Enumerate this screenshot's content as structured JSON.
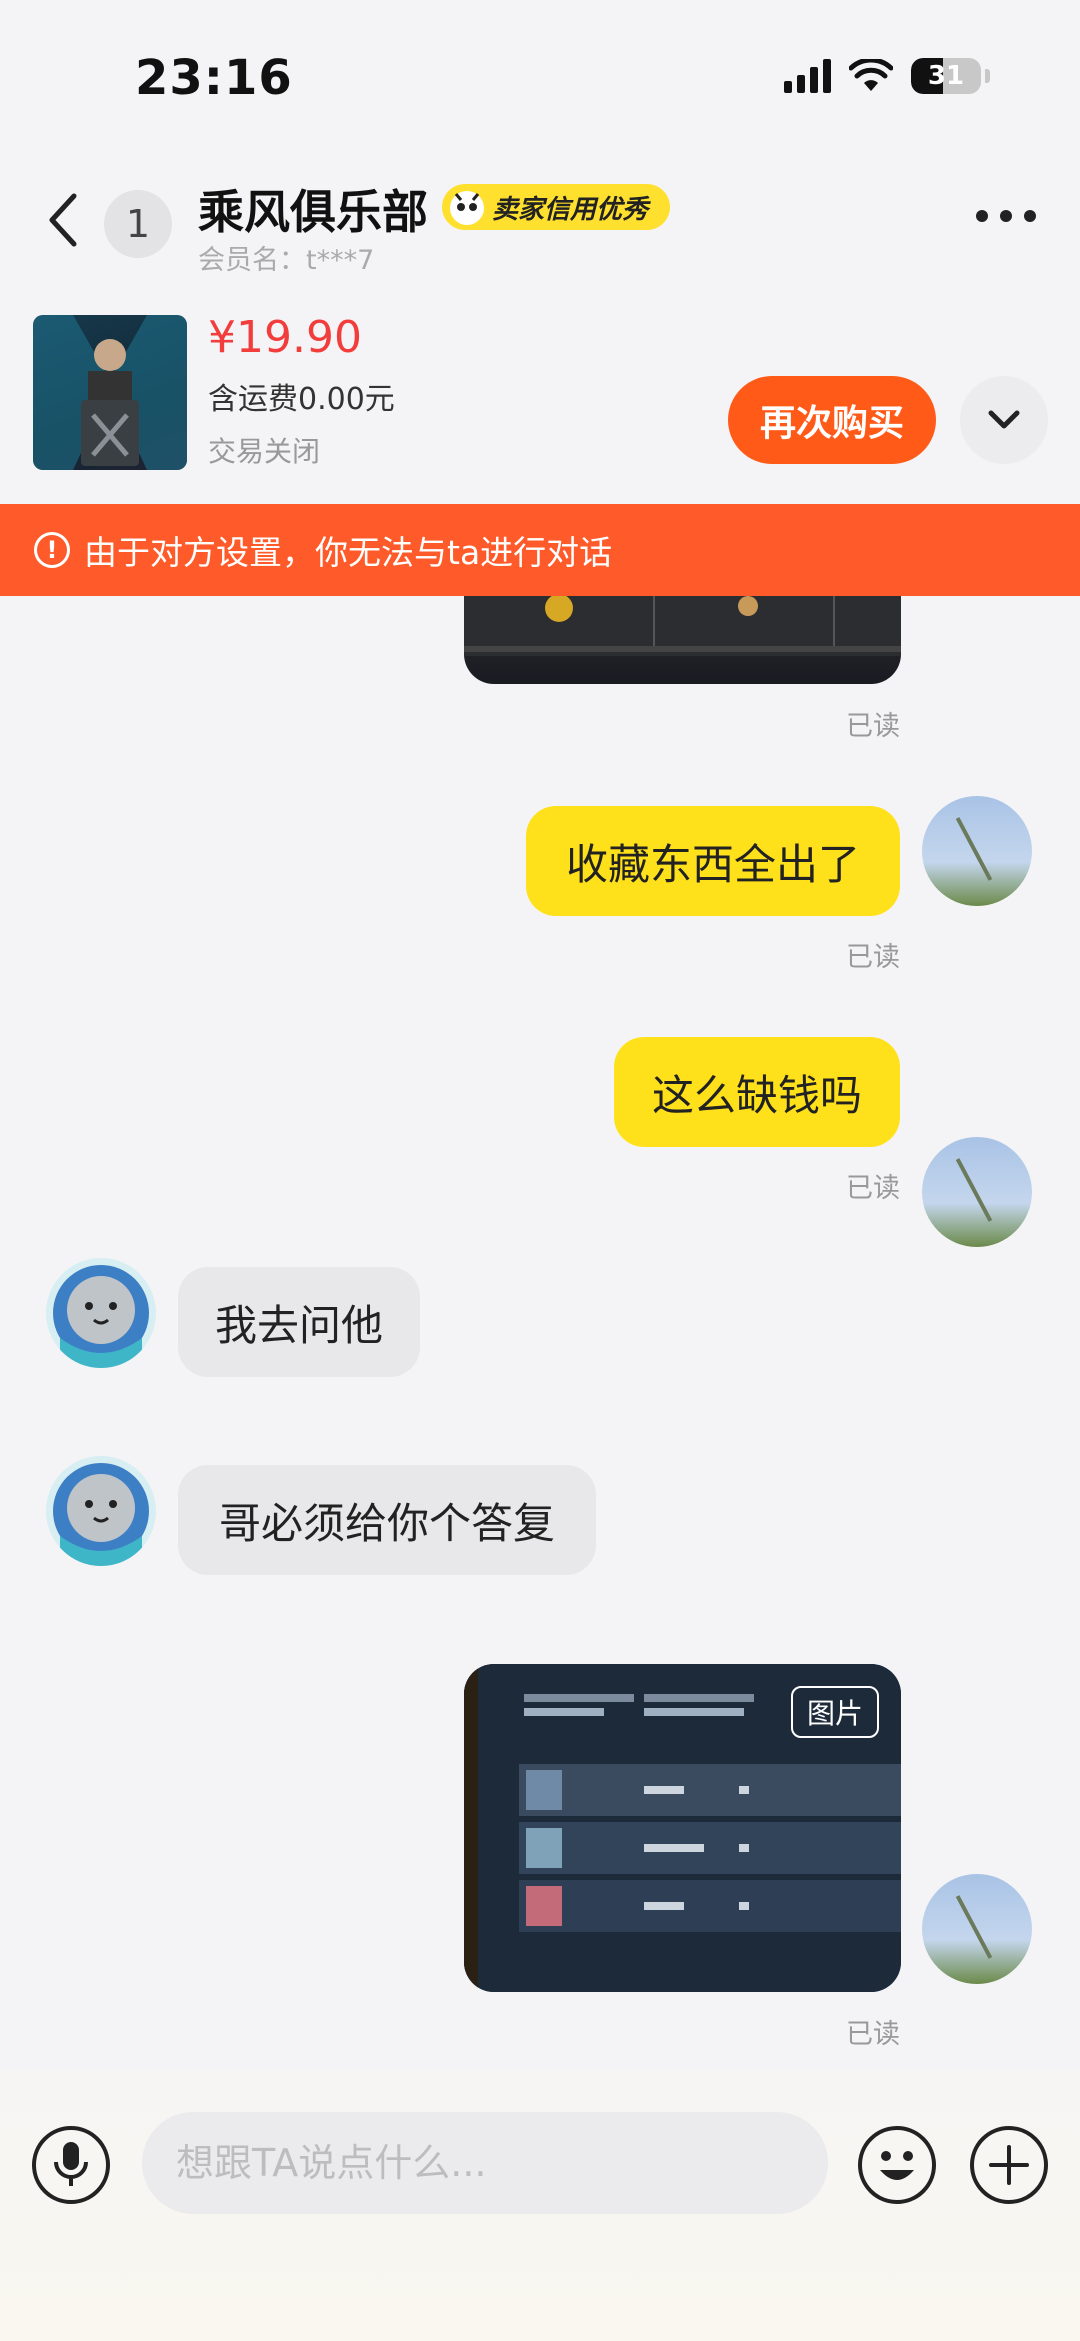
{
  "status_bar": {
    "time": "23:16",
    "battery": "31"
  },
  "header": {
    "unread_count": "1",
    "shop_name": "乘风俱乐部",
    "credit_badge": "卖家信用优秀",
    "member_name": "会员名：t***7"
  },
  "product": {
    "price": "¥19.90",
    "shipping": "含运费0.00元",
    "status": "交易关闭",
    "rebuy_label": "再次购买"
  },
  "warning": {
    "text": "由于对方设置，你无法与ta进行对话"
  },
  "messages": [
    {
      "side": "me",
      "type": "image",
      "read": "已读"
    },
    {
      "side": "me",
      "type": "text",
      "text": "收藏东西全出了",
      "read": "已读"
    },
    {
      "side": "me",
      "type": "text",
      "text": "这么缺钱吗",
      "read": "已读"
    },
    {
      "side": "them",
      "type": "text",
      "text": "我去问他"
    },
    {
      "side": "them",
      "type": "text",
      "text": "哥必须给你个答复"
    },
    {
      "side": "me",
      "type": "image",
      "tag": "图片",
      "read": "已读"
    }
  ],
  "input": {
    "placeholder": "想跟TA说点什么..."
  },
  "colors": {
    "accent": "#ff5a18",
    "warning_bg": "#ff5a2a",
    "my_bubble": "#ffe11b",
    "their_bubble": "#e8e8ea",
    "price": "#f23d3d"
  },
  "icons": [
    "back-chevron-icon",
    "more-dots-icon",
    "chevron-down-icon",
    "warning-circle-icon",
    "microphone-icon",
    "emoji-icon",
    "plus-icon",
    "signal-icon",
    "wifi-icon",
    "battery-icon"
  ]
}
